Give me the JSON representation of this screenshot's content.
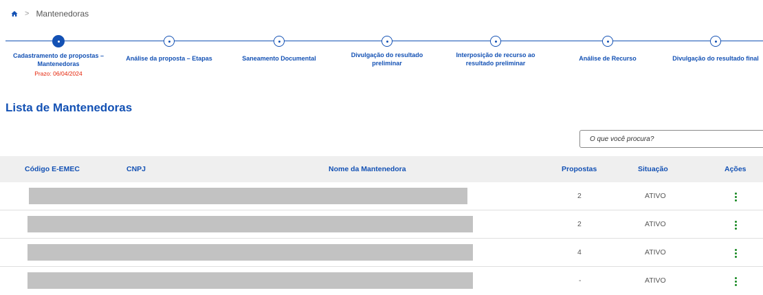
{
  "breadcrumb": {
    "home_icon": "home-icon",
    "separator": ">",
    "current": "Mantenedoras"
  },
  "stepper": {
    "steps": [
      {
        "label": "Cadastramento de propostas – Mantenedoras",
        "deadline": "Prazo: 06/04/2024",
        "active": true
      },
      {
        "label": "Análise da proposta – Etapas"
      },
      {
        "label": "Saneamento Documental"
      },
      {
        "label": "Divulgação do resultado preliminar"
      },
      {
        "label": "Interposição de recurso ao resultado preliminar"
      },
      {
        "label": "Análise de Recurso"
      },
      {
        "label": "Divulgação do resultado final"
      }
    ],
    "active_color": "#1351b4"
  },
  "section_title": "Lista de Mantenedoras",
  "search": {
    "placeholder": "O que você procura?"
  },
  "table": {
    "headers": {
      "codigo": "Código E-EMEC",
      "cnpj": "CNPJ",
      "nome": "Nome da Mantenedora",
      "propostas": "Propostas",
      "situacao": "Situação",
      "acoes": "Ações"
    },
    "rows": [
      {
        "propostas": "2",
        "situacao": "ATIVO"
      },
      {
        "propostas": "2",
        "situacao": "ATIVO"
      },
      {
        "propostas": "4",
        "situacao": "ATIVO"
      },
      {
        "propostas": "-",
        "situacao": "ATIVO"
      }
    ]
  },
  "colors": {
    "primary": "#1351b4",
    "deadline": "#e52207",
    "action": "#168821"
  }
}
